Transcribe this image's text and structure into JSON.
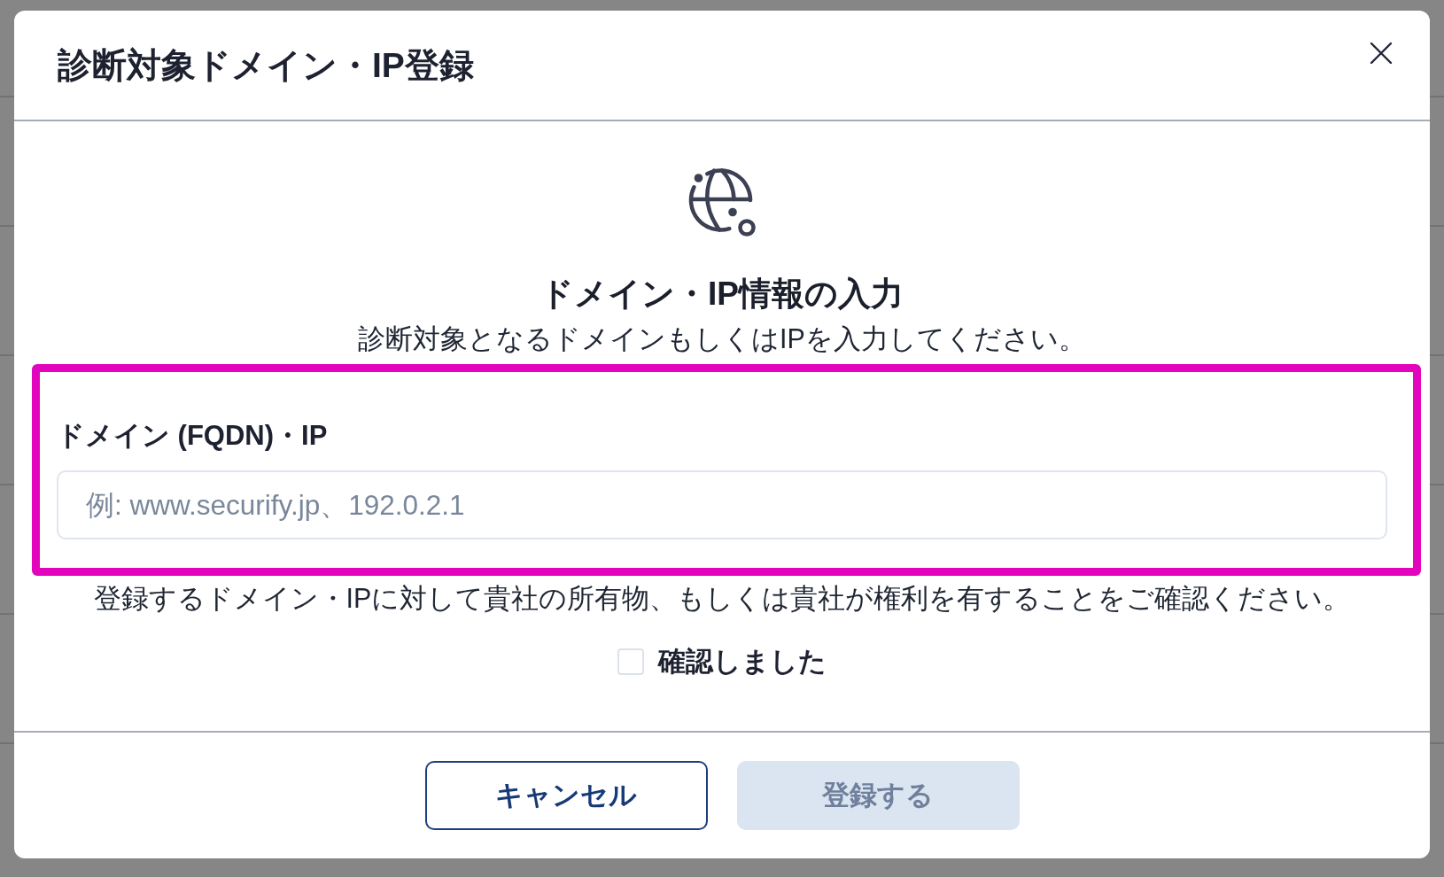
{
  "dialog": {
    "title": "診断対象ドメイン・IP登録"
  },
  "intro": {
    "heading": "ドメイン・IP情報の入力",
    "description": "診断対象となるドメインもしくはIPを入力してください。"
  },
  "field": {
    "label": "ドメイン (FQDN)・IP",
    "placeholder": "例: www.securify.jp、192.0.2.1",
    "highlighted": true
  },
  "notice": "登録するドメイン・IPに対して貴社の所有物、もしくは貴社が権利を有することをご確認ください。",
  "confirmation": {
    "label": "確認しました",
    "checked": false
  },
  "buttons": [
    {
      "label": "キャンセル",
      "kind": "secondary",
      "disabled": false
    },
    {
      "label": "登録する",
      "kind": "primary",
      "disabled": true
    }
  ]
}
